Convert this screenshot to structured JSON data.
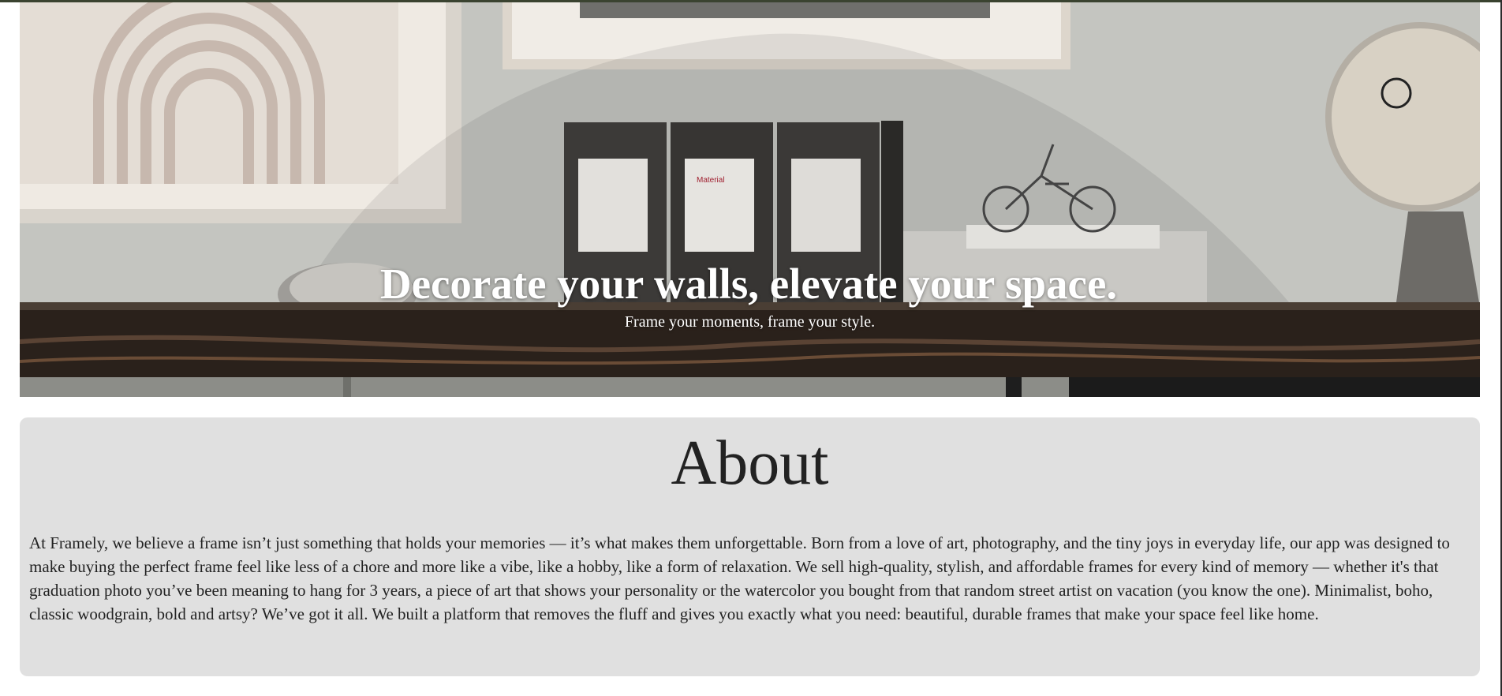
{
  "hero": {
    "title": "Decorate your walls, elevate your space.",
    "subtitle": "Frame your moments, frame your style.",
    "image_description_icon": "hero-shelf-photo"
  },
  "about": {
    "heading": "About",
    "body": "At Framely, we believe a frame isn’t just something that holds your memories — it’s what makes them unforgettable. Born from a love of art, photography, and the tiny joys in everyday life, our app was designed to make buying the perfect frame feel like less of a chore and more like a vibe, like a hobby, like a form of relaxation. We sell high-quality, stylish, and affordable frames for every kind of memory — whether it's that graduation photo you’ve been meaning to hang for 3 years, a piece of art that shows your personality or the watercolor you bought from that random street artist on vacation (you know the one). Minimalist, boho, classic woodgrain, bold and artsy? We’ve got it all. We built a platform that removes the fluff and gives you exactly what you need: beautiful, durable frames that make your space feel like home."
  },
  "colors": {
    "top_bar": "#3a4330",
    "about_background": "#e0e0e0",
    "text_dark": "#222222",
    "hero_text": "#ffffff"
  }
}
